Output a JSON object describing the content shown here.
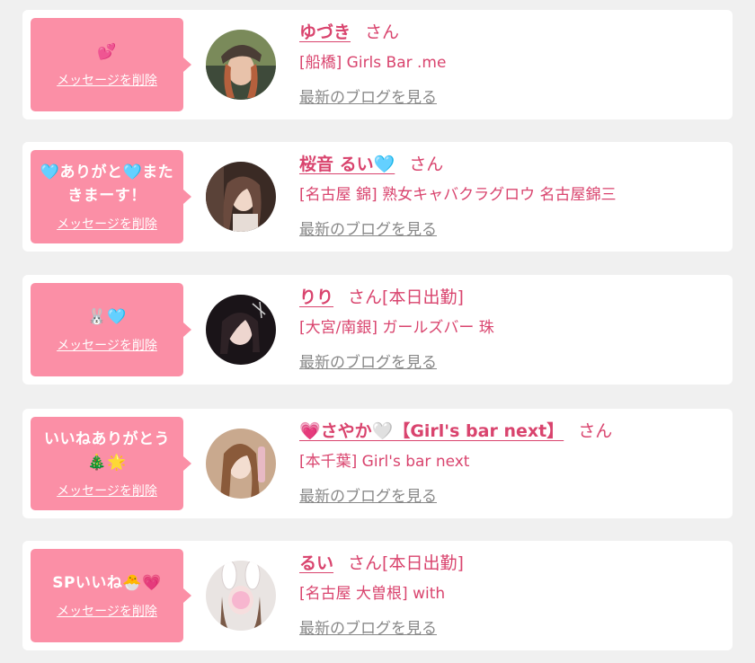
{
  "delete_label": "メッセージを削除",
  "blog_label": "最新のブログを見る",
  "san_suffix": "さん",
  "colors": {
    "accent": "#d9446e",
    "bubble": "#fb8fa6",
    "link_gray": "#888888",
    "page_bg": "#f0f0f0"
  },
  "items": [
    {
      "message": "💕",
      "name": "ゆづき",
      "status": "",
      "shop": "[船橋] Girls Bar .me"
    },
    {
      "message": "🩵ありがと🩵またきまーす！",
      "name": "桜音 るい🩵",
      "status": "",
      "shop": "[名古屋 錦] 熟女キャバクラグロウ 名古屋錦三"
    },
    {
      "message": "🐰🩵",
      "name": "りり",
      "status": "[本日出勤]",
      "shop": "[大宮/南銀] ガールズバー 珠"
    },
    {
      "message": "いいねありがとう🎄🌟",
      "name": "💗さやか🤍【Girl's bar next】",
      "status": "",
      "shop": "[本千葉] Girl's bar next"
    },
    {
      "message": "SPいいね🐣💗",
      "name": "るい",
      "status": "[本日出勤]",
      "shop": "[名古屋 大曽根] with"
    }
  ]
}
